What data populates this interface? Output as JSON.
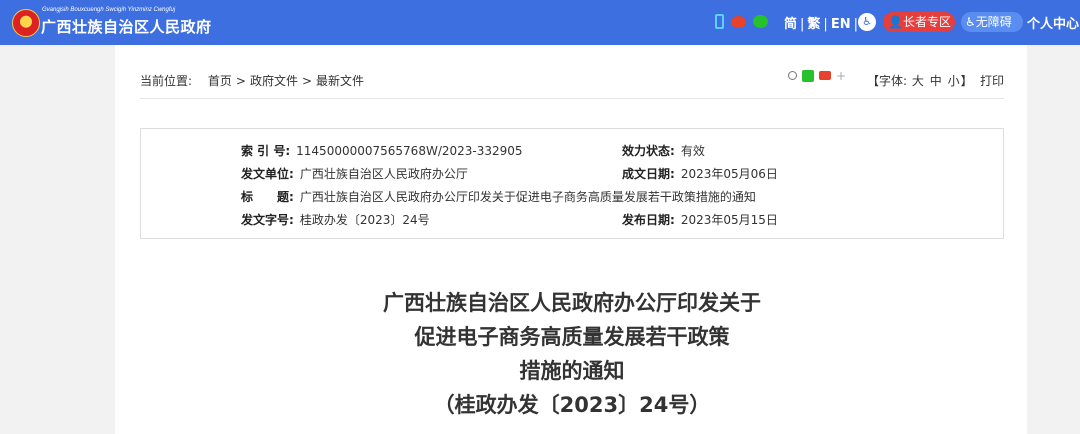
{
  "header": {
    "site_subtitle": "Gvangjsih Bouxcuengh Swcigih Yinzminz Cwngfuj",
    "site_name": "广西壮族自治区人民政府",
    "lang_simplified": "简",
    "lang_traditional": "繁",
    "lang_english": "EN",
    "sep": "|",
    "elder_zone": "长者专区",
    "barrier_free": "无障碍",
    "personal_center": "个人中心"
  },
  "breadcrumb": {
    "label": "当前位置:",
    "items": [
      "首页",
      "政府文件",
      "最新文件"
    ],
    "separator": ">"
  },
  "font_control": {
    "prefix": "【字体:",
    "large": "大",
    "medium": "中",
    "small": "小",
    "suffix": "】"
  },
  "print_label": "打印",
  "info": {
    "index_label": "索 引 号:",
    "index_value": "11450000007565768W/2023-332905",
    "validity_label": "效力状态:",
    "validity_value": "有效",
    "issuer_label": "发文单位:",
    "issuer_value": "广西壮族自治区人民政府办公厅",
    "created_label": "成文日期:",
    "created_value": "2023年05月06日",
    "title_label": "标　　题:",
    "title_value": "广西壮族自治区人民政府办公厅印发关于促进电子商务高质量发展若干政策措施的通知",
    "docno_label": "发文字号:",
    "docno_value": "桂政办发〔2023〕24号",
    "published_label": "发布日期:",
    "published_value": "2023年05月15日"
  },
  "document_title": {
    "line1": "广西壮族自治区人民政府办公厅印发关于",
    "line2": "促进电子商务高质量发展若干政策",
    "line3": "措施的通知",
    "line4": "（桂政办发〔2023〕24号）"
  }
}
